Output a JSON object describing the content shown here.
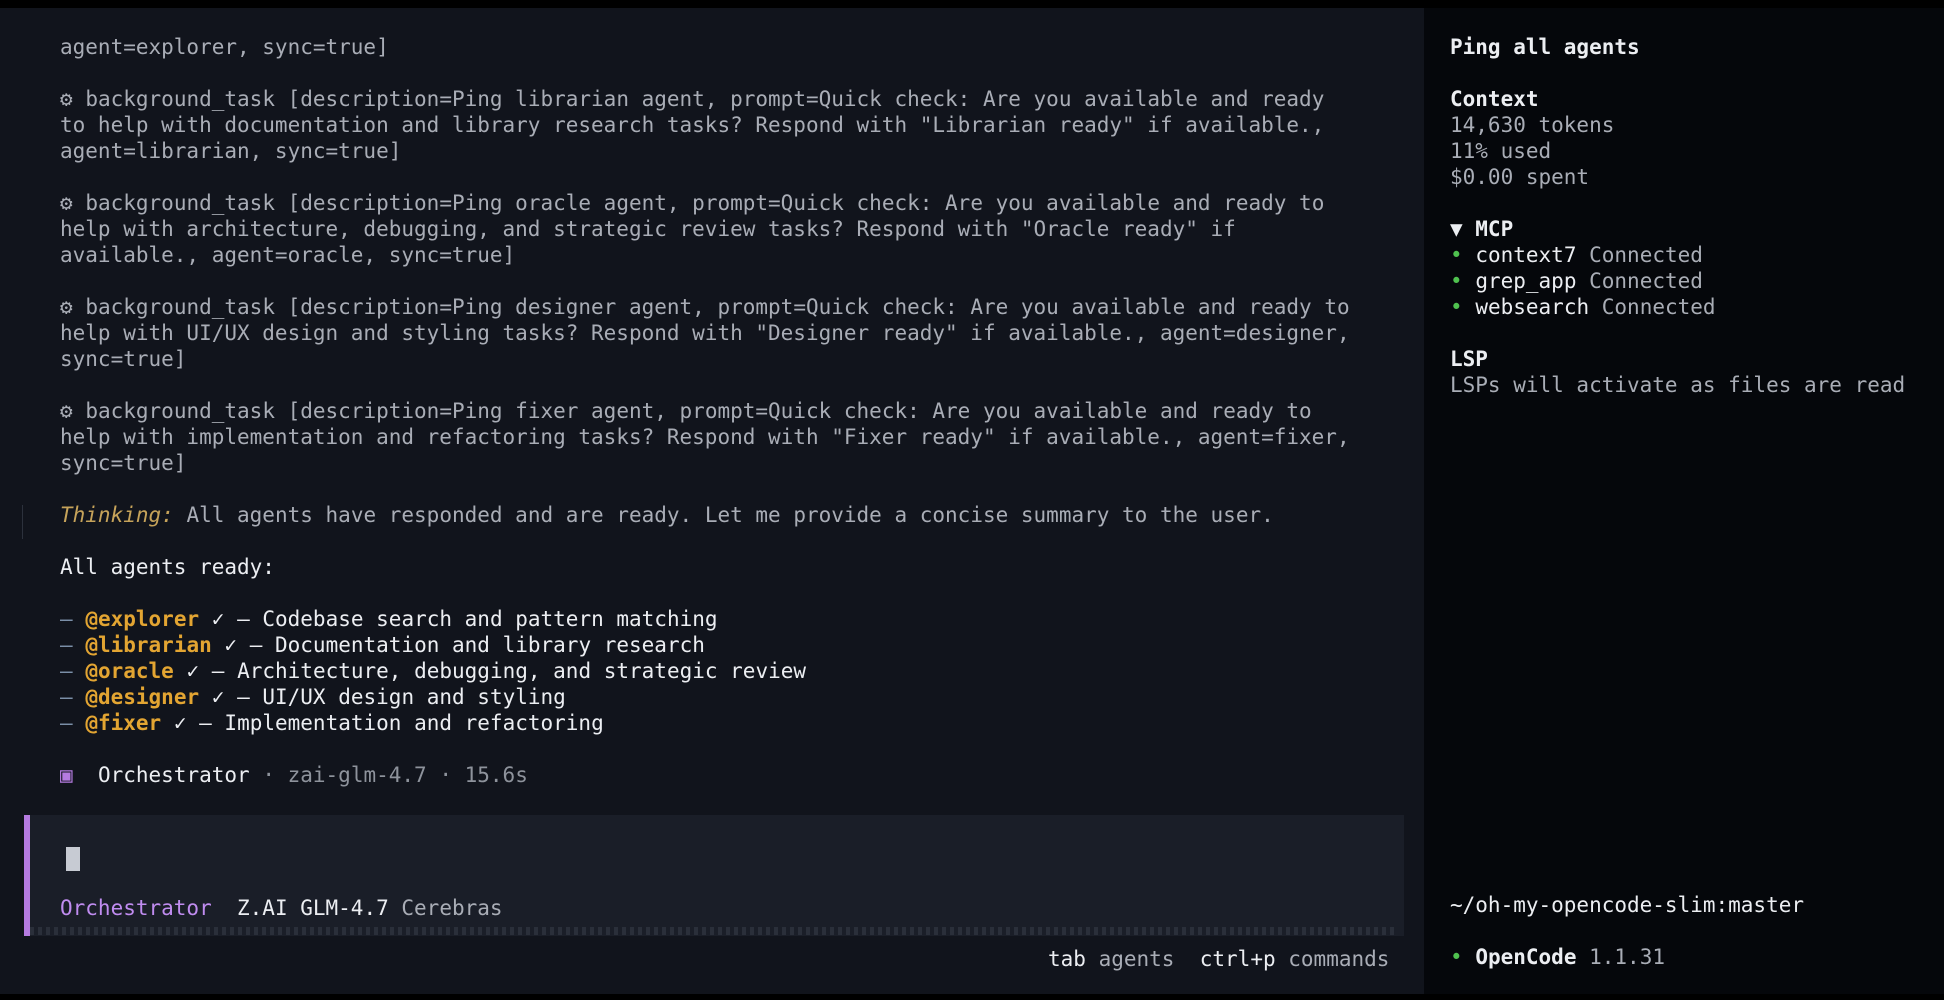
{
  "transcript": {
    "lines": {
      "l0": "agent=explorer, sync=true]",
      "l1": "background_task [description=Ping librarian agent, prompt=Quick check: Are you available and ready",
      "l2": "to help with documentation and library research tasks? Respond with \"Librarian ready\" if available.,",
      "l3": "agent=librarian, sync=true]",
      "l4": "background_task [description=Ping oracle agent, prompt=Quick check: Are you available and ready to",
      "l5": "help with architecture, debugging, and strategic review tasks? Respond with \"Oracle ready\" if",
      "l6": "available., agent=oracle, sync=true]",
      "l7": "background_task [description=Ping designer agent, prompt=Quick check: Are you available and ready to",
      "l8": "help with UI/UX design and styling tasks? Respond with \"Designer ready\" if available., agent=designer,",
      "l9": "sync=true]",
      "l10": "background_task [description=Ping fixer agent, prompt=Quick check: Are you available and ready to",
      "l11": "help with implementation and refactoring tasks? Respond with \"Fixer ready\" if available., agent=fixer,",
      "l12": "sync=true]"
    },
    "tool_icon": "⚙",
    "thinking": {
      "label": "Thinking:",
      "text": "All agents have responded and are ready. Let me provide a concise summary to the user."
    },
    "summary_heading": "All agents ready:",
    "agents": [
      {
        "dash": "–",
        "mention": "@explorer",
        "check": "✓",
        "desc": "– Codebase search and pattern matching"
      },
      {
        "dash": "–",
        "mention": "@librarian",
        "check": "✓",
        "desc": "– Documentation and library research"
      },
      {
        "dash": "–",
        "mention": "@oracle",
        "check": "✓",
        "desc": "– Architecture, debugging, and strategic review"
      },
      {
        "dash": "–",
        "mention": "@designer",
        "check": "✓",
        "desc": "– UI/UX design and styling"
      },
      {
        "dash": "–",
        "mention": "@fixer",
        "check": "✓",
        "desc": "– Implementation and refactoring"
      }
    ],
    "footer": {
      "icon": "▣",
      "agent": "Orchestrator",
      "meta": "· zai-glm-4.7 · 15.6s"
    }
  },
  "input": {
    "agent": "Orchestrator",
    "model": "Z.AI GLM-4.7",
    "provider": "Cerebras"
  },
  "hints": {
    "k1": "tab",
    "t1": "agents",
    "k2": "ctrl+p",
    "t2": "commands"
  },
  "sidebar": {
    "session_title": "Ping all agents",
    "context": {
      "title": "Context",
      "tokens": "14,630 tokens",
      "used": "11% used",
      "spent": "$0.00 spent"
    },
    "mcp": {
      "title": "▼ MCP",
      "servers": [
        {
          "name": "context7",
          "status": "Connected"
        },
        {
          "name": "grep_app",
          "status": "Connected"
        },
        {
          "name": "websearch",
          "status": "Connected"
        }
      ]
    },
    "lsp": {
      "title": "LSP",
      "text": "LSPs will activate as files are read"
    },
    "cwd": "~/oh-my-opencode-slim:master",
    "app": {
      "name": "OpenCode",
      "version": "1.1.31"
    }
  },
  "colors": {
    "accent": "#b57be0",
    "mention": "#e3a532",
    "thinking": "#c6a35a",
    "connected": "#4fc14f"
  }
}
